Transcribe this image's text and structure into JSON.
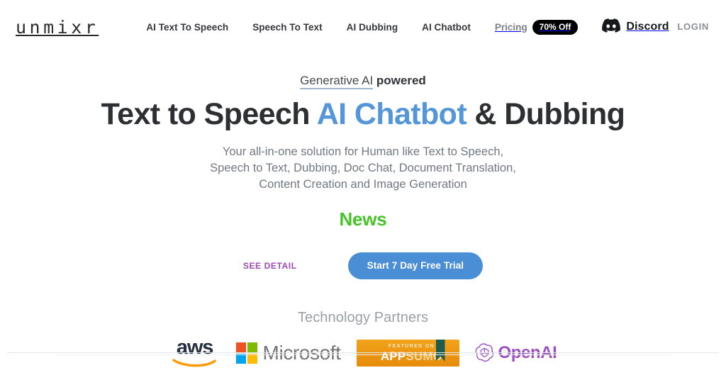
{
  "brand": {
    "name": "unmixr"
  },
  "nav": {
    "links": [
      {
        "label": "AI Text To Speech"
      },
      {
        "label": "Speech To Text"
      },
      {
        "label": "AI Dubbing"
      },
      {
        "label": "AI Chatbot"
      }
    ],
    "pricing": {
      "label": "Pricing",
      "badge": "70% Off"
    },
    "discord": {
      "label": "Discord",
      "icon": "discord-icon"
    },
    "login": {
      "label": "LOGIN"
    }
  },
  "hero": {
    "eyebrow_underlined": "Generative AI",
    "eyebrow_bold": " powered",
    "headline_part1": "Text to Speech ",
    "headline_accent": "AI Chatbot",
    "headline_part2": " & Dubbing",
    "subtitle_line1": "Your all-in-one solution for Human like Text to Speech,",
    "subtitle_line2": "Speech to Text, Dubbing, Doc Chat, Document Translation,",
    "subtitle_line3": "Content Creation and Image Generation",
    "news": "News"
  },
  "cta": {
    "see_detail": "SEE DETAIL",
    "trial_button": "Start 7 Day Free Trial"
  },
  "partners": {
    "title": "Technology Partners",
    "logos": [
      {
        "name": "aws",
        "text": "aws"
      },
      {
        "name": "microsoft",
        "text": "Microsoft"
      },
      {
        "name": "appsumo",
        "featured": "FEATURED ON",
        "app": "APP",
        "sumo": "SUMO"
      },
      {
        "name": "openai",
        "text": "OpenAI"
      }
    ]
  },
  "colors": {
    "accent_blue": "#5596d8",
    "button_blue": "#4a8fd6",
    "news_green": "#46c327",
    "see_detail_purple": "#9c4cb0",
    "badge_black": "#000000",
    "openai_purple": "#9b4fc0",
    "appsumo_orange": "#eb9512"
  }
}
